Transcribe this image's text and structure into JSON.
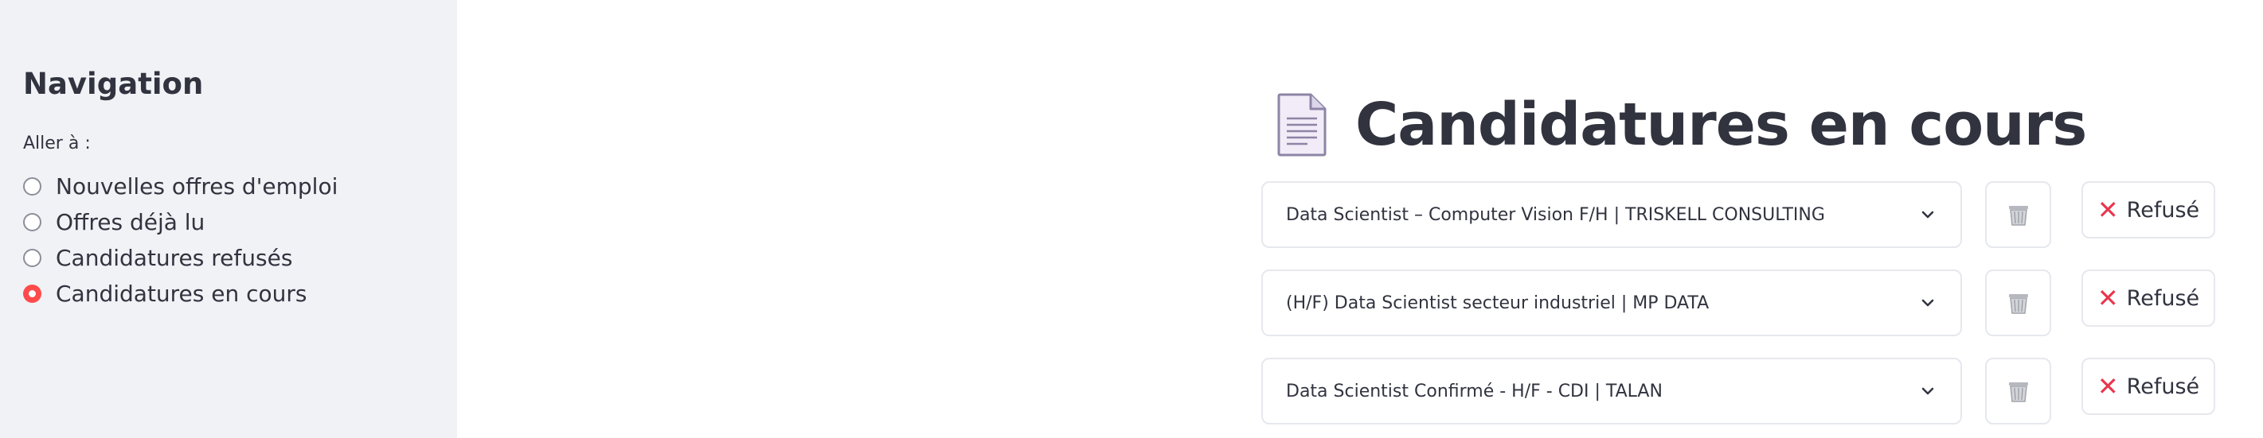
{
  "sidebar": {
    "title": "Navigation",
    "radio_label": "Aller à :",
    "options": [
      {
        "label": "Nouvelles offres d'emploi",
        "selected": false
      },
      {
        "label": "Offres déjà lu",
        "selected": false
      },
      {
        "label": "Candidatures refusés",
        "selected": false
      },
      {
        "label": "Candidatures en cours",
        "selected": true
      }
    ]
  },
  "main": {
    "title": "Candidatures en cours",
    "title_icon": "page-facing-up-icon",
    "rows": [
      {
        "label": "Data Scientist – Computer Vision F/H | TRISKELL CONSULTING",
        "delete_icon": "wastebasket-icon",
        "refuse_label": "Refusé"
      },
      {
        "label": "(H/F) Data Scientist secteur industriel | MP DATA",
        "delete_icon": "wastebasket-icon",
        "refuse_label": "Refusé"
      },
      {
        "label": "Data Scientist Confirmé - H/F - CDI | TALAN",
        "delete_icon": "wastebasket-icon",
        "refuse_label": "Refusé"
      }
    ]
  },
  "colors": {
    "accent": "#ff4b4b",
    "sidebar_bg": "#f0f2f6",
    "text": "#31333f",
    "refuse_x": "#e8364f"
  }
}
